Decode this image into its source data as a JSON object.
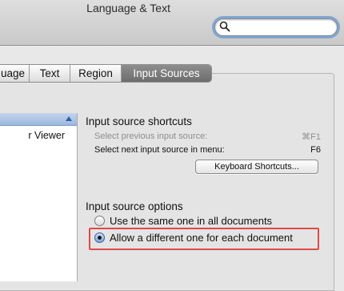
{
  "window": {
    "title": "Language & Text"
  },
  "toolbar": {
    "search": {
      "value": "",
      "placeholder": ""
    }
  },
  "tabs": [
    {
      "label": "uage",
      "selected": false
    },
    {
      "label": "Text",
      "selected": false
    },
    {
      "label": "Region",
      "selected": false
    },
    {
      "label": "Input Sources",
      "selected": true
    }
  ],
  "sidebar": {
    "items": [
      {
        "label": "r Viewer"
      }
    ]
  },
  "shortcuts": {
    "heading": "Input source shortcuts",
    "rows": [
      {
        "label": "Select previous input source:",
        "key": "⌘F1",
        "enabled": false
      },
      {
        "label": "Select next input source in menu:",
        "key": "F6",
        "enabled": true
      }
    ],
    "button_label": "Keyboard Shortcuts..."
  },
  "options": {
    "heading": "Input source options",
    "choices": [
      {
        "label": "Use the same one in all documents",
        "selected": false
      },
      {
        "label": "Allow a different one for each document",
        "selected": true
      }
    ]
  },
  "colors": {
    "highlight": "#e0494a",
    "selected_tab": "#7a7a7a",
    "list_header": "#aec4e5"
  }
}
